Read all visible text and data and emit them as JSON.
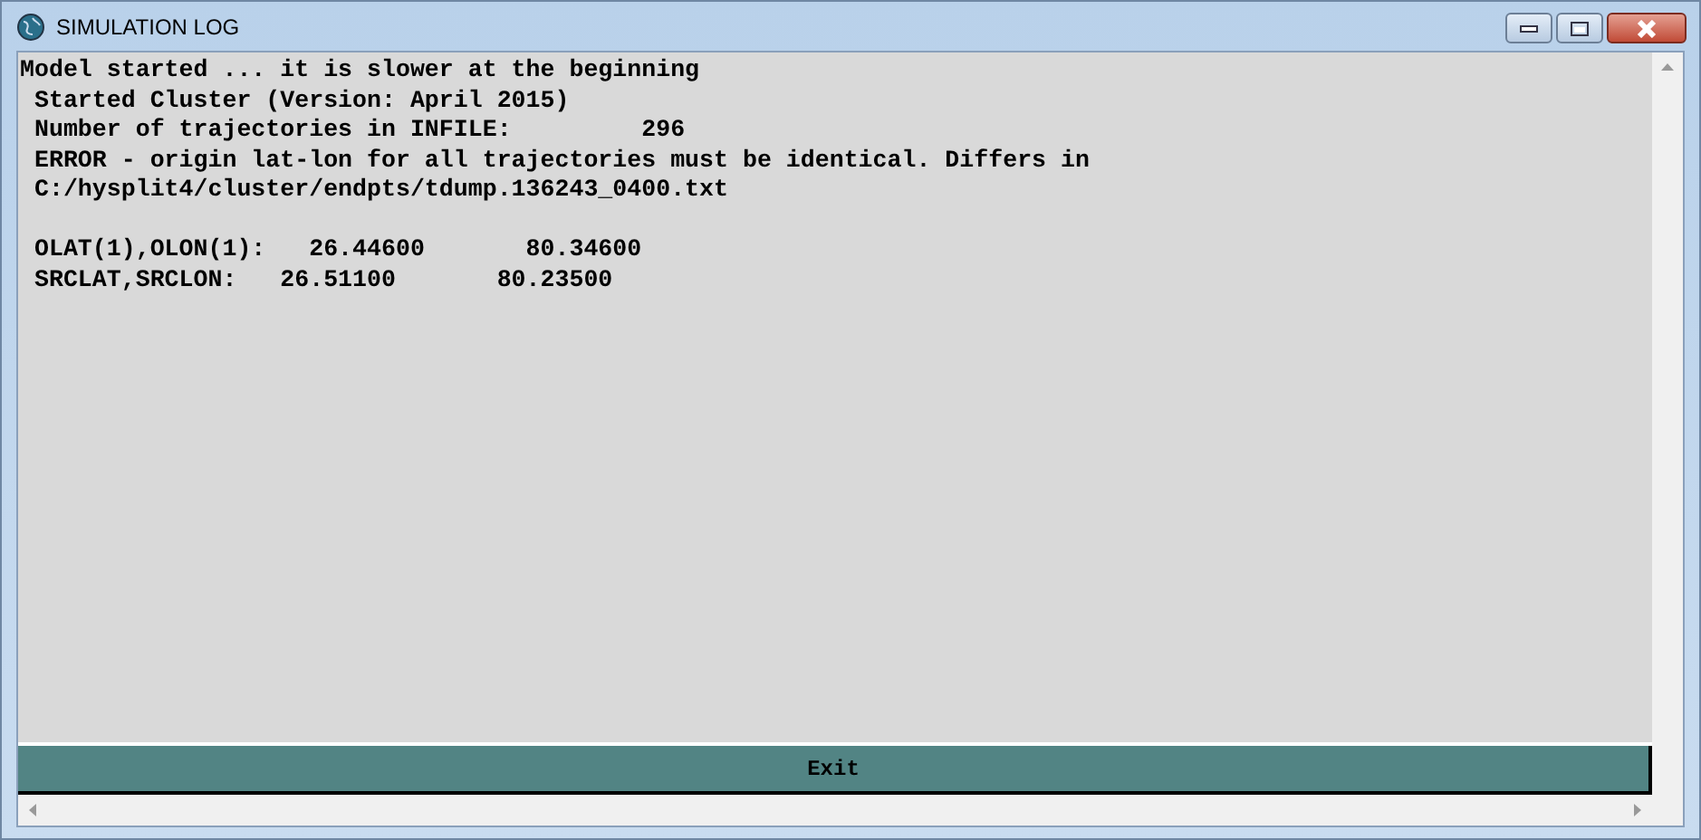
{
  "window": {
    "title": "SIMULATION LOG"
  },
  "log_blocks": [
    {
      "lines": [
        "Model started ... it is slower at the beginning",
        " Started Cluster (Version: April 2015)",
        " Number of trajectories in INFILE:         296",
        " ERROR - origin lat-lon for all trajectories must be identical. Differs in",
        " C:/hysplit4/cluster/endpts/tdump.136243_0400.txt"
      ]
    },
    {
      "lines": [
        " OLAT(1),OLON(1):   26.44600       80.34600",
        " SRCLAT,SRCLON:   26.51100       80.23500"
      ]
    }
  ],
  "exit_button": {
    "label": "Exit"
  }
}
